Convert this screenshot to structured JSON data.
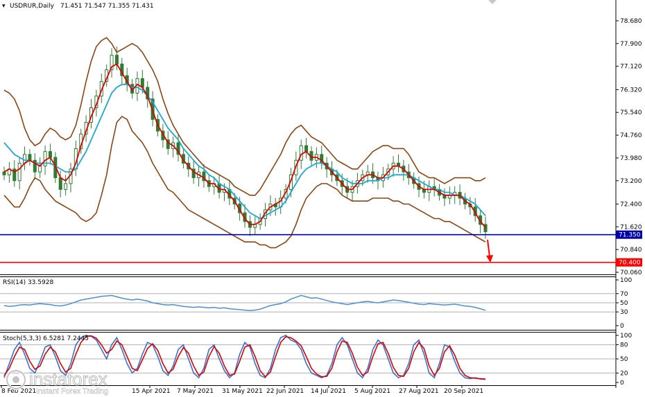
{
  "header": {
    "symbol_title": "USDRUR,Daily",
    "ohlc": "71.451 71.547 71.355 71.431"
  },
  "watermark": {
    "brand": "instaforex",
    "tagline": "Instant Forex Trading"
  },
  "colors": {
    "price_candles": "#2e7d32",
    "fast_ma": "#e00000",
    "slow_ma": "#19a8d8",
    "bollinger": "#8b4513",
    "support_line": "#0000aa",
    "target_line": "#ff0000",
    "rsi_line": "#4a90d9",
    "stoch_main": "#3a6fd8",
    "stoch_signal": "#dd0000",
    "arrow": "#ff0000"
  },
  "chart_data": [
    {
      "type": "candlestick",
      "title": "USDRUR,Daily",
      "ohlc_last": [
        71.451,
        71.547,
        71.355,
        71.431
      ],
      "ylim": [
        70.06,
        78.68
      ],
      "y_ticks": [
        "78.680",
        "77.900",
        "77.120",
        "76.320",
        "75.540",
        "74.760",
        "73.980",
        "73.200",
        "72.400",
        "71.620",
        "70.840",
        "70.060"
      ],
      "x_ticks": [
        "8 Feb 2021",
        "15 Apr 2021",
        "7 May 2021",
        "31 May 2021",
        "22 Jun 2021",
        "14 Jul 2021",
        "5 Aug 2021",
        "27 Aug 2021",
        "20 Sep 2021"
      ],
      "levels": [
        {
          "label": "71.350",
          "value": 71.35,
          "color": "#0000aa"
        },
        {
          "label": "70.400",
          "value": 70.4,
          "color": "#ff0000"
        }
      ],
      "close_path": [
        73.4,
        73.6,
        73.2,
        73.8,
        74.1,
        73.9,
        73.5,
        73.7,
        74.2,
        74.0,
        73.3,
        72.9,
        73.1,
        73.6,
        74.3,
        74.8,
        75.2,
        75.7,
        76.1,
        76.6,
        77.0,
        77.5,
        77.2,
        76.8,
        76.5,
        76.2,
        76.7,
        76.4,
        76.0,
        75.3,
        74.9,
        74.6,
        74.3,
        74.5,
        74.1,
        73.8,
        73.6,
        73.3,
        73.5,
        73.2,
        73.0,
        73.1,
        72.8,
        72.9,
        72.6,
        72.4,
        72.1,
        71.8,
        71.6,
        71.7,
        71.9,
        72.2,
        72.4,
        72.3,
        72.6,
        72.9,
        73.4,
        73.9,
        74.4,
        74.2,
        73.9,
        74.1,
        73.8,
        73.6,
        73.4,
        73.2,
        73.0,
        72.8,
        73.0,
        73.2,
        73.4,
        73.5,
        73.3,
        73.2,
        73.4,
        73.6,
        73.8,
        73.7,
        73.5,
        73.3,
        73.1,
        72.9,
        72.8,
        73.0,
        72.9,
        72.7,
        72.6,
        72.7,
        72.8,
        72.6,
        72.4,
        72.3,
        72.0,
        71.7,
        71.45
      ],
      "fast_ma": [
        73.5,
        73.6,
        73.5,
        73.6,
        73.8,
        73.9,
        73.8,
        73.7,
        73.9,
        74.0,
        73.7,
        73.3,
        73.2,
        73.4,
        73.8,
        74.4,
        74.9,
        75.4,
        75.8,
        76.3,
        76.7,
        77.1,
        77.2,
        76.9,
        76.6,
        76.3,
        76.5,
        76.4,
        76.1,
        75.6,
        75.1,
        74.8,
        74.5,
        74.4,
        74.2,
        73.9,
        73.7,
        73.5,
        73.4,
        73.3,
        73.1,
        73.1,
        72.9,
        72.9,
        72.7,
        72.5,
        72.2,
        71.9,
        71.7,
        71.7,
        71.8,
        72.1,
        72.3,
        72.4,
        72.5,
        72.8,
        73.2,
        73.7,
        74.1,
        74.2,
        74.0,
        74.0,
        73.9,
        73.7,
        73.5,
        73.3,
        73.1,
        72.9,
        72.9,
        73.1,
        73.3,
        73.4,
        73.4,
        73.3,
        73.3,
        73.5,
        73.7,
        73.7,
        73.6,
        73.4,
        73.2,
        73.0,
        72.9,
        72.9,
        72.9,
        72.8,
        72.7,
        72.7,
        72.7,
        72.7,
        72.5,
        72.4,
        72.1,
        71.8,
        71.6
      ],
      "slow_ma": [
        74.5,
        74.3,
        74.1,
        74.0,
        73.9,
        73.9,
        73.8,
        73.8,
        73.8,
        73.8,
        73.7,
        73.6,
        73.5,
        73.5,
        73.6,
        73.9,
        74.2,
        74.6,
        75.0,
        75.4,
        75.8,
        76.2,
        76.4,
        76.5,
        76.5,
        76.4,
        76.4,
        76.3,
        76.1,
        75.9,
        75.6,
        75.3,
        75.0,
        74.8,
        74.6,
        74.3,
        74.1,
        73.9,
        73.7,
        73.6,
        73.4,
        73.3,
        73.1,
        73.0,
        72.9,
        72.7,
        72.5,
        72.3,
        72.1,
        72.0,
        71.9,
        72.0,
        72.1,
        72.2,
        72.3,
        72.5,
        72.8,
        73.1,
        73.4,
        73.6,
        73.7,
        73.8,
        73.8,
        73.7,
        73.6,
        73.5,
        73.3,
        73.2,
        73.1,
        73.1,
        73.1,
        73.2,
        73.2,
        73.2,
        73.3,
        73.3,
        73.4,
        73.4,
        73.4,
        73.4,
        73.3,
        73.2,
        73.1,
        73.0,
        72.9,
        72.9,
        72.8,
        72.8,
        72.7,
        72.7,
        72.6,
        72.5,
        72.4,
        72.2,
        72.0
      ],
      "bollinger_upper": [
        76.3,
        76.2,
        76.0,
        75.6,
        75.0,
        74.6,
        74.4,
        74.5,
        74.8,
        75.0,
        74.9,
        74.7,
        74.6,
        74.7,
        75.1,
        75.8,
        76.6,
        77.3,
        77.8,
        78.0,
        78.1,
        77.9,
        77.6,
        77.7,
        77.8,
        77.9,
        77.8,
        77.6,
        77.3,
        77.0,
        76.6,
        76.0,
        75.5,
        75.1,
        74.8,
        74.5,
        74.3,
        74.1,
        73.9,
        73.7,
        73.6,
        73.5,
        73.4,
        73.3,
        73.2,
        73.0,
        72.9,
        72.8,
        72.7,
        72.7,
        72.9,
        73.2,
        73.5,
        73.8,
        74.1,
        74.5,
        74.8,
        75.0,
        75.1,
        74.9,
        74.7,
        74.6,
        74.5,
        74.3,
        74.1,
        73.9,
        73.8,
        73.7,
        73.6,
        73.6,
        73.8,
        74.0,
        74.2,
        74.3,
        74.4,
        74.4,
        74.3,
        74.3,
        74.3,
        74.1,
        73.8,
        73.5,
        73.4,
        73.3,
        73.3,
        73.2,
        73.1,
        73.2,
        73.3,
        73.3,
        73.3,
        73.3,
        73.2,
        73.2,
        73.3
      ],
      "bollinger_lower": [
        72.7,
        72.5,
        72.3,
        72.3,
        72.6,
        73.0,
        73.3,
        73.2,
        72.9,
        72.7,
        72.5,
        72.4,
        72.3,
        72.2,
        72.1,
        71.9,
        71.8,
        71.9,
        72.1,
        72.7,
        73.4,
        74.4,
        75.2,
        75.4,
        75.3,
        74.9,
        74.7,
        74.5,
        74.2,
        73.8,
        73.5,
        73.2,
        72.9,
        72.8,
        72.6,
        72.4,
        72.2,
        72.1,
        72.0,
        71.9,
        71.8,
        71.7,
        71.6,
        71.5,
        71.4,
        71.3,
        71.2,
        71.1,
        71.1,
        71.1,
        71.0,
        71.0,
        70.9,
        70.9,
        71.0,
        71.1,
        71.3,
        71.7,
        72.2,
        72.6,
        72.8,
        73.0,
        73.1,
        73.1,
        73.0,
        72.9,
        72.7,
        72.6,
        72.5,
        72.5,
        72.5,
        72.5,
        72.6,
        72.6,
        72.6,
        72.6,
        72.5,
        72.5,
        72.4,
        72.4,
        72.3,
        72.2,
        72.1,
        72.0,
        71.9,
        71.9,
        71.8,
        71.8,
        71.7,
        71.6,
        71.5,
        71.4,
        71.3,
        71.2,
        71.1
      ]
    },
    {
      "type": "line",
      "title": "RSI(14) 33.5928",
      "ylim": [
        0,
        100
      ],
      "y_ticks": [
        "100",
        "70",
        "50",
        "30",
        "0"
      ],
      "levels": [
        70,
        50,
        30
      ],
      "values": [
        44,
        42,
        43,
        45,
        46,
        45,
        47,
        48,
        47,
        46,
        44,
        43,
        45,
        48,
        52,
        56,
        58,
        60,
        62,
        64,
        65,
        66,
        63,
        60,
        58,
        56,
        58,
        56,
        54,
        50,
        48,
        46,
        45,
        46,
        44,
        42,
        41,
        40,
        41,
        40,
        39,
        40,
        38,
        39,
        37,
        36,
        35,
        34,
        33,
        34,
        36,
        40,
        44,
        46,
        48,
        52,
        58,
        62,
        66,
        63,
        60,
        61,
        58,
        55,
        52,
        50,
        48,
        46,
        48,
        50,
        52,
        53,
        51,
        50,
        52,
        54,
        56,
        55,
        53,
        51,
        49,
        47,
        46,
        48,
        47,
        46,
        45,
        46,
        47,
        45,
        43,
        42,
        40,
        37,
        33.6
      ]
    },
    {
      "type": "line",
      "title": "Stoch(5,3,3) 6.5281 7.2445",
      "ylim": [
        0,
        100
      ],
      "y_ticks": [
        "100",
        "80",
        "50",
        "20",
        "0"
      ],
      "levels": [
        80,
        50,
        20
      ],
      "series": [
        {
          "name": "6.5281",
          "values": [
            10,
            40,
            70,
            85,
            60,
            30,
            20,
            45,
            75,
            80,
            55,
            25,
            15,
            40,
            80,
            95,
            100,
            98,
            90,
            70,
            50,
            80,
            95,
            70,
            40,
            20,
            30,
            60,
            85,
            80,
            55,
            25,
            15,
            35,
            70,
            80,
            50,
            20,
            10,
            30,
            70,
            80,
            50,
            25,
            10,
            20,
            60,
            85,
            75,
            40,
            15,
            10,
            30,
            70,
            95,
            100,
            90,
            85,
            70,
            40,
            20,
            15,
            10,
            15,
            40,
            80,
            95,
            80,
            50,
            20,
            10,
            30,
            70,
            90,
            80,
            50,
            20,
            10,
            15,
            40,
            80,
            90,
            60,
            20,
            10,
            40,
            80,
            75,
            45,
            20,
            10,
            8,
            10,
            7,
            6.5
          ]
        },
        {
          "name": "7.2445",
          "values": [
            15,
            30,
            55,
            75,
            70,
            45,
            28,
            35,
            60,
            75,
            65,
            40,
            22,
            30,
            60,
            85,
            97,
            99,
            94,
            80,
            62,
            70,
            88,
            80,
            55,
            30,
            25,
            48,
            72,
            82,
            68,
            40,
            20,
            28,
            55,
            74,
            62,
            35,
            15,
            22,
            55,
            76,
            62,
            35,
            15,
            18,
            45,
            75,
            80,
            55,
            25,
            12,
            22,
            55,
            85,
            97,
            95,
            88,
            78,
            55,
            30,
            18,
            12,
            13,
            30,
            65,
            88,
            85,
            62,
            32,
            15,
            22,
            55,
            82,
            85,
            62,
            32,
            15,
            13,
            30,
            65,
            85,
            72,
            35,
            15,
            30,
            65,
            78,
            58,
            30,
            15,
            10,
            9,
            8,
            7.2
          ]
        }
      ]
    }
  ]
}
